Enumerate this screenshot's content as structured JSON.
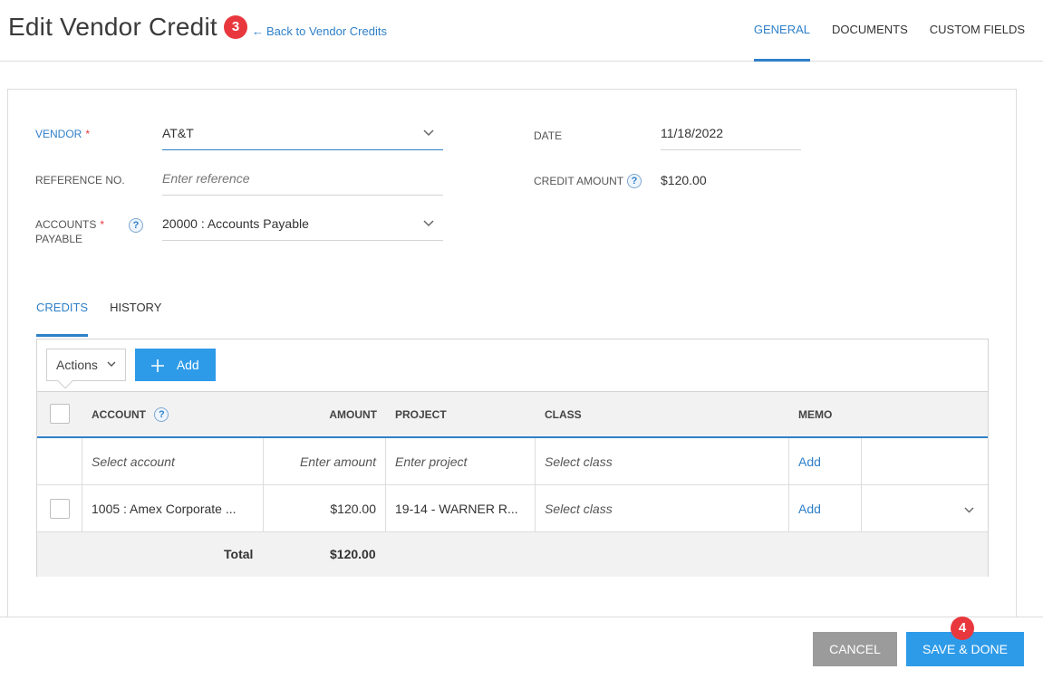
{
  "header": {
    "title": "Edit Vendor Credit",
    "back_arrow": "←",
    "back_link": "Back to Vendor Credits",
    "badge_step_3": "3",
    "tabs": [
      {
        "label": "GENERAL",
        "active": true
      },
      {
        "label": "DOCUMENTS",
        "active": false
      },
      {
        "label": "CUSTOM FIELDS",
        "active": false
      }
    ]
  },
  "form": {
    "vendor_label": "VENDOR",
    "required_mark": "*",
    "vendor_value": "AT&T",
    "reference_label": "REFERENCE NO.",
    "reference_placeholder": "Enter reference",
    "accounts_payable_label_1": "ACCOUNTS",
    "accounts_payable_label_2": "PAYABLE",
    "accounts_payable_value": "20000 : Accounts Payable",
    "date_label": "DATE",
    "date_value": "11/18/2022",
    "credit_amount_label": "CREDIT AMOUNT",
    "credit_amount_value": "$120.00",
    "help_glyph": "?"
  },
  "subtabs": [
    {
      "label": "CREDITS",
      "active": true
    },
    {
      "label": "HISTORY",
      "active": false
    }
  ],
  "grid": {
    "actions_label": "Actions",
    "add_label": "Add",
    "columns": {
      "account": "ACCOUNT",
      "amount": "AMOUNT",
      "project": "PROJECT",
      "class": "CLASS",
      "memo": "MEMO"
    },
    "entry_row": {
      "account": "Select account",
      "amount": "Enter amount",
      "project": "Enter project",
      "class": "Select class",
      "memo": "Add"
    },
    "rows": [
      {
        "account": "1005 : Amex Corporate ...",
        "amount": "$120.00",
        "project": "19-14 - WARNER R...",
        "class": "Select class",
        "memo": "Add"
      }
    ],
    "total_label": "Total",
    "total_value": "$120.00"
  },
  "footer": {
    "cancel_label": "CANCEL",
    "save_label": "SAVE & DONE",
    "badge_step_4": "4"
  },
  "colors": {
    "accent": "#2f80c9",
    "primary_button": "#2e9be9",
    "cancel_button": "#9b9b9b",
    "badge": "#e8383d"
  }
}
